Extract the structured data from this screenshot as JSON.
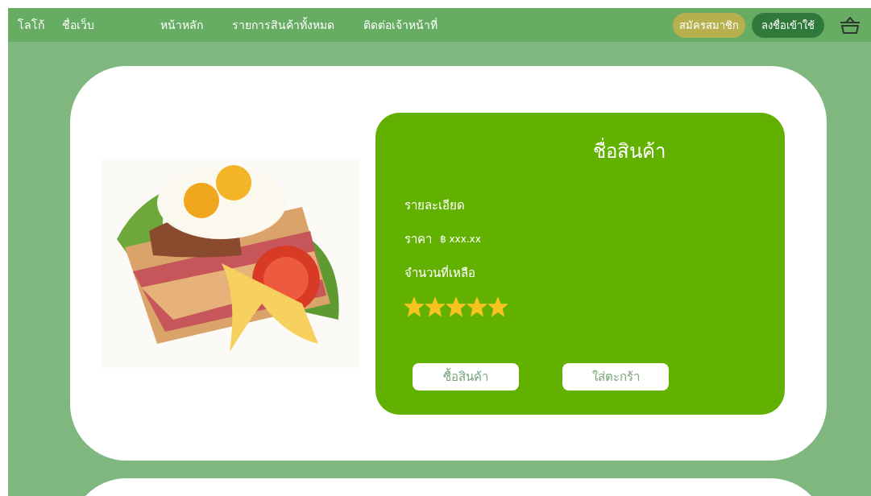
{
  "navbar": {
    "logo": "โลโก้",
    "site_name": "ชื่อเว็บ",
    "links": [
      "หน้าหลัก",
      "รายการสินค้าทั้งหมด",
      "ติดต่อเจ้าหน้าที่"
    ],
    "register_button": "สมัครสมาชิก",
    "login_button": "ลงชื่อเข้าใช้"
  },
  "product": {
    "image": {
      "kind": "picture"
    },
    "title": "ชื่อสินค้า",
    "details_label": "รายละเอียด",
    "price_label": "ราคา",
    "price": "฿ xxx.xx",
    "stock_label": "จำนวนที่เหลือ",
    "stars": 5,
    "buttons": [
      "ซื้อสินค้า",
      "ใส่ตะกร้า"
    ]
  }
}
